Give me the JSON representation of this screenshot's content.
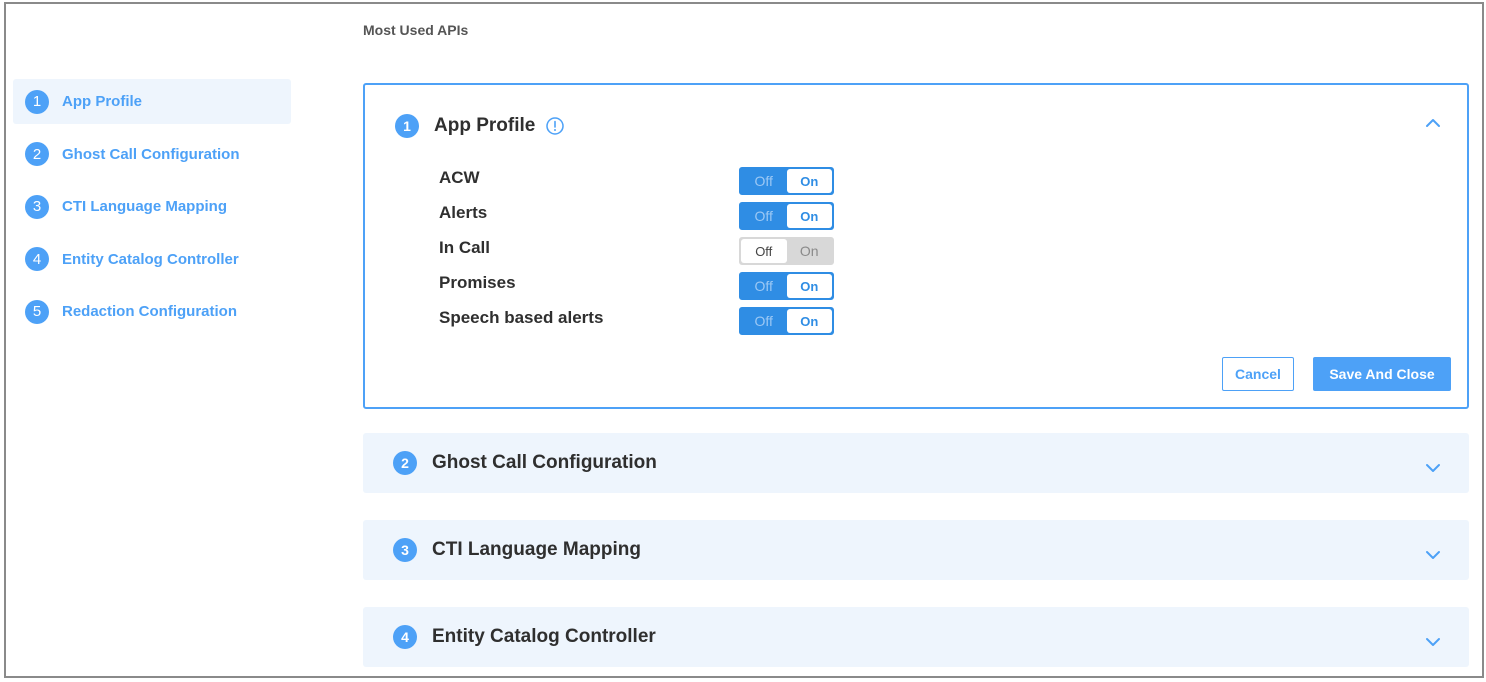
{
  "page": {
    "section_title": "Most Used APIs"
  },
  "sidebar": {
    "items": [
      {
        "num": "1",
        "label": "App Profile"
      },
      {
        "num": "2",
        "label": "Ghost Call Configuration"
      },
      {
        "num": "3",
        "label": "CTI Language Mapping"
      },
      {
        "num": "4",
        "label": "Entity Catalog Controller"
      },
      {
        "num": "5",
        "label": "Redaction Configuration"
      }
    ],
    "active_index": 0
  },
  "app_profile": {
    "num": "1",
    "title": "App Profile",
    "settings": [
      {
        "label": "ACW",
        "state": "On",
        "off_label": "Off",
        "on_label": "On"
      },
      {
        "label": "Alerts",
        "state": "On",
        "off_label": "Off",
        "on_label": "On"
      },
      {
        "label": "In Call",
        "state": "Off",
        "off_label": "Off",
        "on_label": "On"
      },
      {
        "label": "Promises",
        "state": "On",
        "off_label": "Off",
        "on_label": "On"
      },
      {
        "label": "Speech based alerts",
        "state": "On",
        "off_label": "Off",
        "on_label": "On"
      }
    ],
    "cancel_label": "Cancel",
    "save_label": "Save And Close"
  },
  "collapsed_panels": [
    {
      "num": "2",
      "title": "Ghost Call Configuration"
    },
    {
      "num": "3",
      "title": "CTI Language Mapping"
    },
    {
      "num": "4",
      "title": "Entity Catalog Controller"
    }
  ],
  "colors": {
    "accent": "#4da1f7",
    "toggle_on": "#2f8de4",
    "toggle_off": "#d8d8d8",
    "panel_bg": "#eef5fd"
  }
}
